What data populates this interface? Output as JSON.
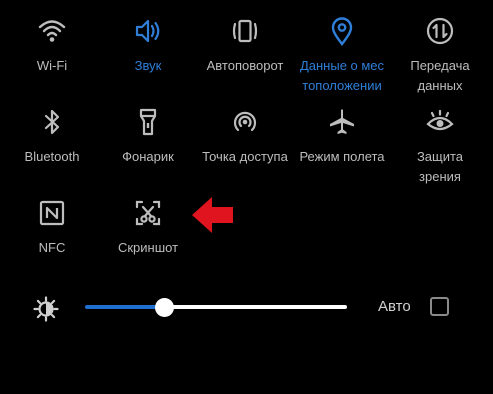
{
  "tiles": [
    {
      "label": "Wi-Fi",
      "icon": "wifi-icon",
      "active": false
    },
    {
      "label": "Звук",
      "icon": "sound-icon",
      "active": true
    },
    {
      "label": "Автоповорот",
      "icon": "autorotate-icon",
      "active": false
    },
    {
      "label": "Данные о местоположении",
      "label_lines": [
        "Данные о мес",
        "тоположении"
      ],
      "icon": "location-icon",
      "active": true
    },
    {
      "label": "Передача данных",
      "label_lines": [
        "Передача",
        "данных"
      ],
      "icon": "data-transfer-icon",
      "active": false
    },
    {
      "label": "Bluetooth",
      "icon": "bluetooth-icon",
      "active": false
    },
    {
      "label": "Фонарик",
      "icon": "flashlight-icon",
      "active": false
    },
    {
      "label": "Точка доступа",
      "icon": "hotspot-icon",
      "active": false
    },
    {
      "label": "Режим полета",
      "icon": "airplane-icon",
      "active": false
    },
    {
      "label": "Защита зрения",
      "label_lines": [
        "Защита",
        "зрения"
      ],
      "icon": "eye-protection-icon",
      "active": false
    },
    {
      "label": "NFC",
      "icon": "nfc-icon",
      "active": false
    },
    {
      "label": "Скриншот",
      "icon": "screenshot-icon",
      "active": false
    }
  ],
  "brightness": {
    "level": 0.3,
    "auto_label": "Авто",
    "auto_checked": false
  },
  "colors": {
    "accent": "#2f7fd8",
    "icon": "#bdbdbd",
    "arrow": "#e0141e",
    "background": "#000000"
  }
}
